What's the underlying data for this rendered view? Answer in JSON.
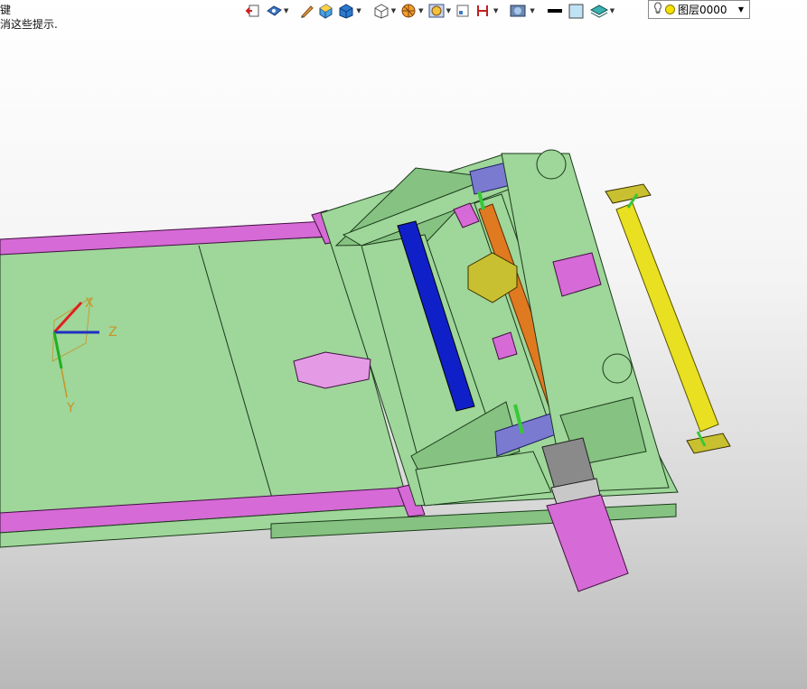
{
  "hints": {
    "line1": "键",
    "line2": "消这些提示."
  },
  "toolbar": {
    "icons": [
      "exit-sketch-icon",
      "view-orient-icon",
      "pencil-icon",
      "shaded-box-icon",
      "shaded-cube-icon",
      "wire-cube-icon",
      "render-sphere-icon",
      "display-mode-icon",
      "section-view-icon",
      "dimension-icon",
      "appearance-icon",
      "line-color-icon",
      "fill-color-icon",
      "layer-style-icon"
    ],
    "layer": {
      "name": "图层0000"
    }
  },
  "triad": {
    "x_label": "X",
    "y_label": "Y",
    "z_label": "Z"
  },
  "colors": {
    "body": "#9fd69a",
    "rail": "#d66ad6",
    "accent_blue": "#1020c8",
    "accent_orange": "#e07a20",
    "accent_yellow": "#e8e020",
    "accent_green": "#38c838"
  }
}
